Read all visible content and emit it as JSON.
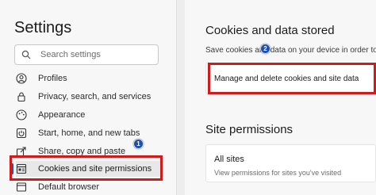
{
  "sidebar": {
    "title": "Settings",
    "search": {
      "placeholder": "Search settings",
      "icon": "search-icon"
    },
    "items": [
      {
        "label": "Profiles",
        "icon": "profile-icon"
      },
      {
        "label": "Privacy, search, and services",
        "icon": "lock-icon"
      },
      {
        "label": "Appearance",
        "icon": "appearance-icon"
      },
      {
        "label": "Start, home, and new tabs",
        "icon": "power-icon"
      },
      {
        "label": "Share, copy and paste",
        "icon": "share-icon"
      },
      {
        "label": "Cookies and site permissions",
        "icon": "cookie-permissions-icon",
        "active": true
      },
      {
        "label": "Default browser",
        "icon": "browser-icon"
      }
    ]
  },
  "main": {
    "cookies_section": {
      "title": "Cookies and data stored",
      "description": "Save cookies and data on your device in order to",
      "manage_label": "Manage and delete cookies and site data"
    },
    "permissions_section": {
      "title": "Site permissions",
      "all_sites_label": "All sites",
      "all_sites_description": "View permissions for sites you've visited"
    }
  },
  "annotations": {
    "step1": "1",
    "step2": "2"
  },
  "colors": {
    "highlight": "#d11a1a",
    "badge": "#1f4fa8",
    "accent": "#0067c0"
  }
}
